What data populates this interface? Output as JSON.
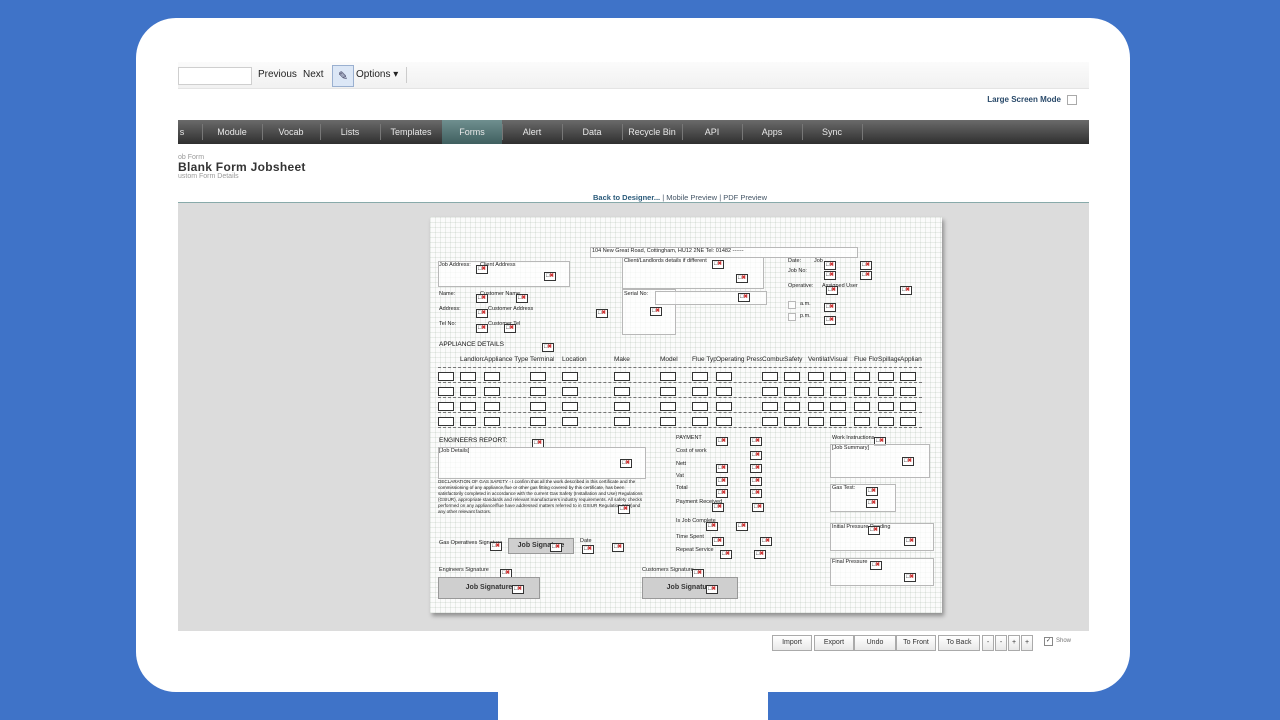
{
  "toolbar": {
    "previous_label": "Previous",
    "next_label": "Next",
    "options_label": "Options",
    "large_screen_label": "Large Screen Mode"
  },
  "nav": {
    "items": [
      "s",
      "Module",
      "Vocab",
      "Lists",
      "Templates",
      "Forms",
      "Alert",
      "Data",
      "Recycle Bin",
      "API",
      "Apps",
      "Sync"
    ],
    "active": "Forms"
  },
  "page": {
    "breadcrumb": "ob Form",
    "title": "Blank Form Jobsheet",
    "subtitle": "ustom Form Details"
  },
  "preview_links": {
    "back": "Back to Designer...",
    "mobile": "Mobile Preview",
    "pdf": "PDF Preview",
    "sep": "|"
  },
  "form": {
    "address_line": "104 New Great Road, Cottingham, HU12 2NE    Tel: 01482 ------",
    "job_address_label": "Job Address:",
    "client_address_label": "Client Address",
    "client_landlord_label": "Client/Landlords details if different",
    "date_label": "Date:",
    "job_label": "Job",
    "job_no_label": "Job No:",
    "operative_label": "Operative:",
    "assigned_user": "Assigned User",
    "name_label": "Name:",
    "customer_name_label": "Customer Name",
    "address_label": "Address:",
    "customer_address_label": "Customer Address",
    "tel_label": "Tel No:",
    "customer_tel_label": "Customer Tel",
    "serial_label": "Serial No:",
    "am_label": "a.m.",
    "pm_label": "p.m.",
    "appliance_details_label": "APPLIANCE DETAILS",
    "table_headers": [
      "Landlord",
      "Appliance Type",
      "Terminal",
      "Location",
      "Make",
      "Model",
      "Flue Type",
      "Operating Pressure",
      "Combustion",
      "Safety",
      "Ventilation",
      "Visual",
      "Flue Flow",
      "Spillage",
      "Appliance"
    ],
    "engineers_report_label": "ENGINEERS REPORT:",
    "job_details_label": "[Job Details]",
    "declaration_text": "DECLARATION OF GAS SAFETY - I confirm that all the work described in this certificate and the commissioning of any appliance,flue or other gas fitting covered by this certificate, has been satisfactorily completed in accordance with the current Gas Safety (Installation and Use) Regulations (GSIUR), appropriate standards and relevant manufacturers industry requirements. All safety checks performed on any appliance/flue have addressed matters referred to in GSIUR Regulation 26(9)and any other relevant factors.",
    "gas_operatives_label": "Gas Operatives Signature",
    "date_short_label": "Date",
    "payment_label": "PAYMENT",
    "cost_of_work_label": "Cost of work",
    "nett_label": "Nett",
    "vat_label": "Vat",
    "total_label": "Total",
    "payment_received_label": "Payment Received",
    "job_complete_label": "Is Job Complete",
    "time_spent_label": "Time Spent",
    "repeat_service_label": "Repeat Service",
    "work_instructions_label": "Work Instructions",
    "job_summary_label": "[Job Summary]",
    "gas_test_label": "Gas Test:",
    "initial_pressure_label": "Initial Pressure Reading",
    "final_pressure_label": "Final Pressure",
    "engineers_signature_label": "Engineers Signature",
    "customers_signature_label": "Customers Signature",
    "job_signature_label": "Job Signature"
  },
  "bottom_buttons": {
    "import": "Import",
    "export": "Export",
    "undo": "Undo",
    "to_front": "To Front",
    "to_back": "To Back",
    "minus": "-",
    "plus": "+",
    "show": "Show"
  }
}
